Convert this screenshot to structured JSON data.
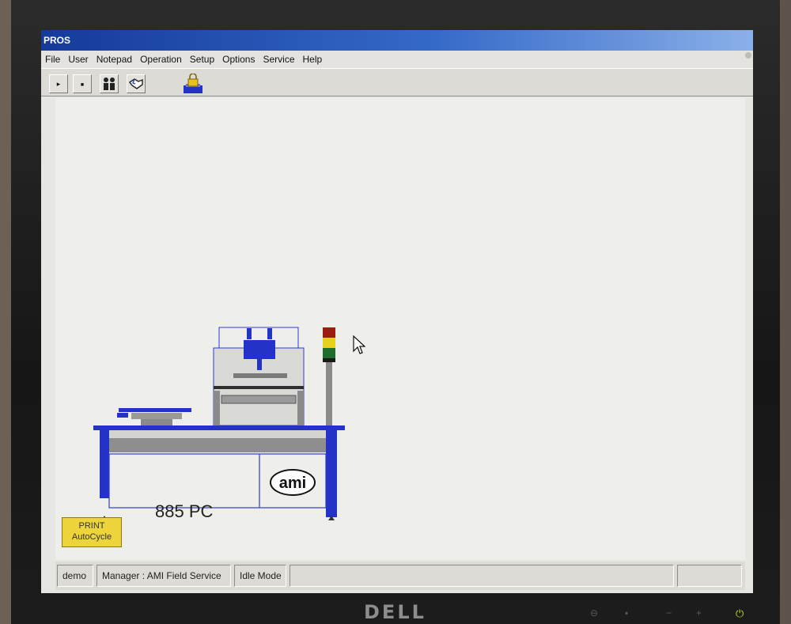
{
  "window": {
    "title": "PROS"
  },
  "menu": [
    "File",
    "User",
    "Notepad",
    "Operation",
    "Setup",
    "Options",
    "Service",
    "Help"
  ],
  "toolbar": {
    "buttons": [
      {
        "icon": "play-icon",
        "glyph": "▸"
      },
      {
        "icon": "stop-icon",
        "glyph": "■"
      },
      {
        "icon": "users-icon",
        "glyph": ""
      },
      {
        "icon": "handshake-icon",
        "glyph": ""
      },
      {
        "icon": "lock-printer-icon",
        "glyph": ""
      }
    ]
  },
  "machine": {
    "model": "885 PC",
    "brand": "ami",
    "mode_label_line1": "PRINT",
    "mode_label_line2": "AutoCycle",
    "stack_light": [
      "#9b1d12",
      "#e6d21a",
      "#1f6d2d"
    ],
    "accent": "#1f2fd6"
  },
  "status": {
    "user": "demo",
    "role": "Manager : AMI Field Service",
    "mode": "Idle Mode",
    "pane4": "",
    "pane5": ""
  },
  "monitor": {
    "brand": "DELL"
  }
}
